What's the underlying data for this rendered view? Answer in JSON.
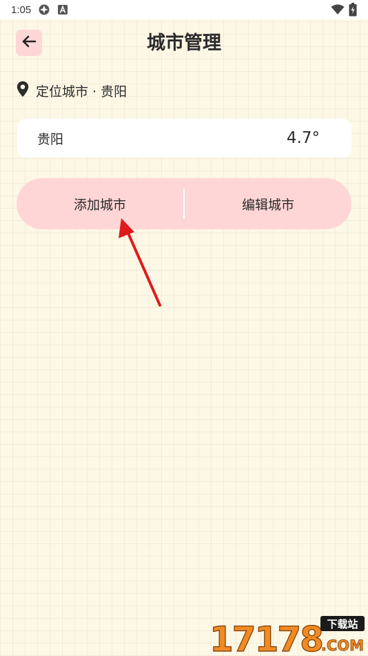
{
  "status_bar": {
    "time": "1:05",
    "icons": [
      "app-notification-icon",
      "a-notification-icon",
      "wifi-icon",
      "battery-charging-icon"
    ]
  },
  "header": {
    "back_icon": "arrow-left-icon",
    "title": "城市管理"
  },
  "location": {
    "icon": "map-pin-icon",
    "label": "定位城市 · 贵阳"
  },
  "city_list": [
    {
      "name": "贵阳",
      "temperature": "4.7°"
    }
  ],
  "actions": {
    "add_label": "添加城市",
    "edit_label": "编辑城市"
  },
  "annotation": {
    "type": "red-arrow-pointing-to-add-city-button",
    "color": "#e01a1a"
  },
  "watermark": {
    "brand_number": "17178",
    "brand_tag": "下载站",
    "brand_domain": ".COM"
  },
  "colors": {
    "background": "#fdf7e6",
    "accent_pink": "#ffd6d6",
    "text": "#2b2b2b",
    "card": "#ffffff",
    "watermark_orange": "#f08a24",
    "watermark_dark": "#1a1a1a"
  }
}
